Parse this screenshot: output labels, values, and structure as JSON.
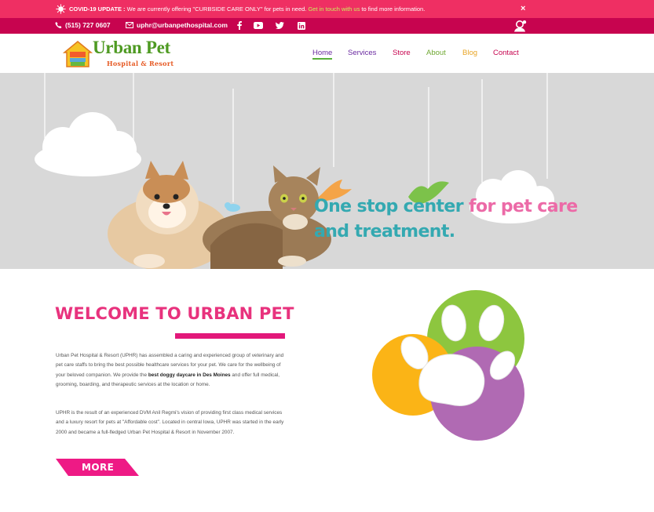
{
  "covid_banner": {
    "lead": "COVID-19 UPDATE :",
    "message": " We are currently offering \"CURBSIDE CARE ONLY\" for pets in need. ",
    "link_text": "Get in touch with us",
    "tail": " to find more information.",
    "close_label": "×"
  },
  "contact": {
    "phone": "(515) 727 0607",
    "email": "uphr@urbanpethospital.com"
  },
  "logo": {
    "brand": "Urban Pet",
    "sub": "Hospital & Resort"
  },
  "nav": {
    "items": [
      {
        "label": "Home",
        "color": "#6a2aa0"
      },
      {
        "label": "Services",
        "color": "#6a2aa0"
      },
      {
        "label": "Store",
        "color": "#c7044f"
      },
      {
        "label": "About",
        "color": "#6fa832"
      },
      {
        "label": "Blog",
        "color": "#e8a526"
      },
      {
        "label": "Contact",
        "color": "#c7044f"
      }
    ]
  },
  "hero": {
    "line1_part1": "One stop center",
    "line1_part2": " for pet care",
    "line2": "and treatment."
  },
  "welcome": {
    "title": "WELCOME TO URBAN PET",
    "para1_a": "Urban Pet Hospital & Resort (UPHR) has assembled a caring and experienced group of veterinary and pet care staffs to bring the best possible healthcare services for your pet. We care for the wellbeing of your beloved companion. We provide the ",
    "para1_bold": "best doggy daycare in Des Moines",
    "para1_b": " and offer full medical, grooming, boarding, and therapeutic services at the location or home.",
    "para2": "UPHR is the result of an experienced DVM Anil Regmi's vision of providing first class medical services and a luxury resort for pets at \"Affordable cost\". Located in central Iowa, UPHR was started in the early 2000 and became a full-fledged Urban Pet Hospital & Resort in November 2007.",
    "more_label": "MORE"
  },
  "colors": {
    "covid_bg": "#ef2f63",
    "contact_bg": "#c7044f",
    "accent_pink": "#e2187a",
    "paw_green": "#8dc63f",
    "paw_yellow": "#fbb416",
    "paw_purple": "#b06ab3"
  },
  "icons": [
    "virus-icon",
    "phone-icon",
    "envelope-icon",
    "facebook-icon",
    "youtube-icon",
    "twitter-icon",
    "linkedin-icon",
    "user-profile-icon",
    "paw-logo"
  ]
}
